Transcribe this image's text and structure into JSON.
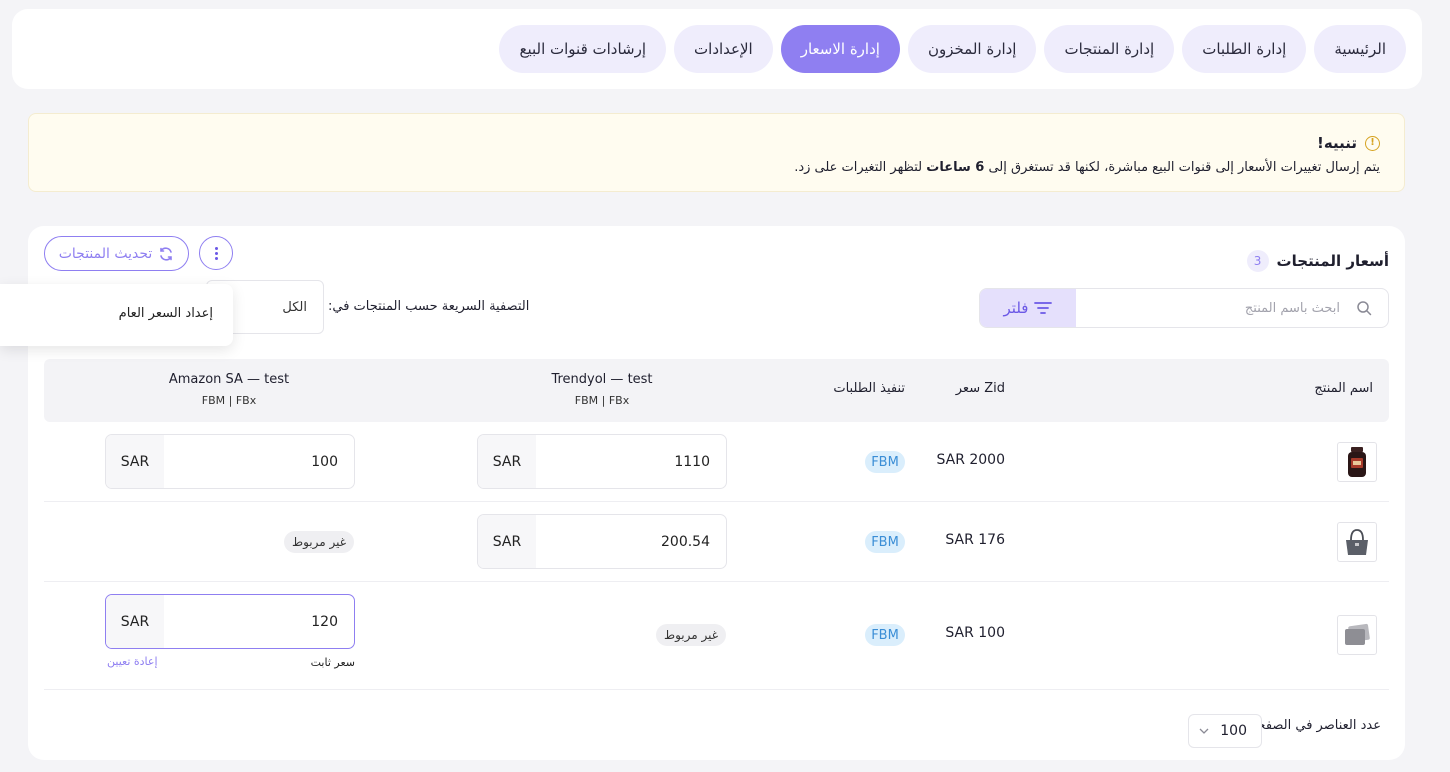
{
  "nav": {
    "tabs": [
      {
        "label": "الرئيسية",
        "active": false
      },
      {
        "label": "إدارة الطلبات",
        "active": false
      },
      {
        "label": "إدارة المنتجات",
        "active": false
      },
      {
        "label": "إدارة المخزون",
        "active": false
      },
      {
        "label": "إدارة الاسعار",
        "active": true
      },
      {
        "label": "الإعدادات",
        "active": false
      },
      {
        "label": "إرشادات قنوات البيع",
        "active": false
      }
    ]
  },
  "alert": {
    "icon": "warning-circle-icon",
    "title": "تنبيه!",
    "text_before": "يتم إرسال تغييرات الأسعار إلى قنوات البيع مباشرة، لكنها قد تستغرق إلى",
    "text_bold": "6 ساعات",
    "text_after": "لتظهر التغيرات على زد."
  },
  "card": {
    "title": "أسعار المنتجات",
    "count": "3",
    "refresh_label": "تحديث المنتجات",
    "search_placeholder": "ابحث باسم المنتج",
    "filter_label": "فلتر",
    "quick_filter_label": "التصفية السريعة حسب المنتجات في:",
    "quick_filter_value": "الكل",
    "menu_item": "إعداد السعر العام"
  },
  "table": {
    "headers": {
      "product_name": "اسم المنتج",
      "zid_price": "سعر Zid",
      "fulfillment": "تنفيذ الطلبات",
      "trendyol": "Trendyol — test",
      "trendyol_sub": "FBM | FBx",
      "amazon": "Amazon SA — test",
      "amazon_sub": "FBM | FBx"
    },
    "rows": [
      {
        "thumb": "jar-product-image",
        "zid_price": "SAR 2000",
        "fulfillment": "FBM",
        "trendyol": {
          "value": "1110",
          "currency": "SAR"
        },
        "amazon": {
          "value": "100",
          "currency": "SAR"
        }
      },
      {
        "thumb": "handbag-product-image",
        "zid_price": "SAR 176",
        "fulfillment": "FBM",
        "trendyol": {
          "value": "200.54",
          "currency": "SAR"
        },
        "amazon": {
          "unlinked": "غير مربوط"
        }
      },
      {
        "thumb": "placeholder-product-image",
        "zid_price": "SAR 100",
        "fulfillment": "FBM",
        "trendyol": {
          "unlinked": "غير مربوط"
        },
        "amazon": {
          "value": "120",
          "currency": "SAR",
          "fixed_label": "سعر ثابت",
          "reset_label": "إعادة تعيين"
        }
      }
    ]
  },
  "footer": {
    "per_page_label": "عدد العناصر في الصفحة",
    "per_page_value": "100"
  },
  "colors": {
    "accent": "#8f7ff1",
    "fbm_bg": "#daeefc",
    "alert_bg": "#fffcf0"
  }
}
